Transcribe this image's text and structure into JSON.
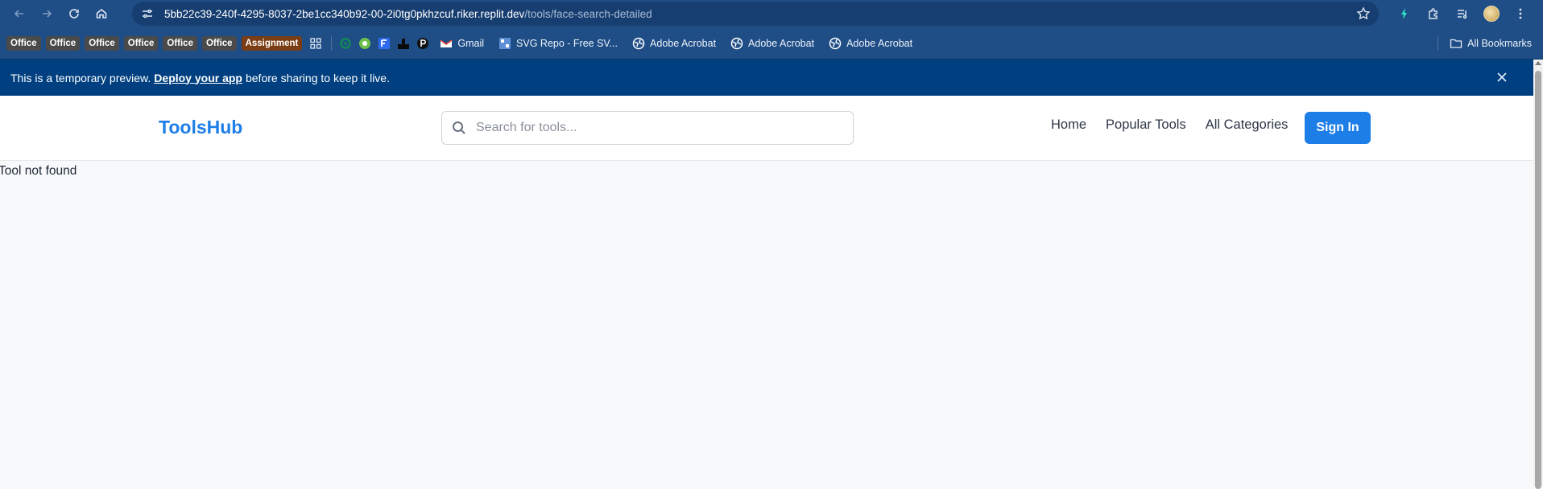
{
  "browser": {
    "url_host": "5bb22c39-240f-4295-8037-2be1cc340b92-00-2i0tg0pkhzcuf.riker.replit.dev",
    "url_path": "/tools/face-search-detailed"
  },
  "bookmarks": {
    "chips": [
      "Office",
      "Office",
      "Office",
      "Office",
      "Office",
      "Office"
    ],
    "assignment": "Assignment",
    "gmail": "Gmail",
    "svg_repo": "SVG Repo - Free SV...",
    "acrobat_1": "Adobe Acrobat",
    "acrobat_2": "Adobe Acrobat",
    "acrobat_3": "Adobe Acrobat",
    "all_bookmarks": "All Bookmarks"
  },
  "banner": {
    "prefix": "This is a temporary preview.",
    "link": "Deploy your app",
    "suffix": "before sharing to keep it live."
  },
  "header": {
    "logo": "ToolsHub",
    "search_placeholder": "Search for tools...",
    "nav": [
      "Home",
      "Popular Tools",
      "All Categories"
    ],
    "sign_in": "Sign In"
  },
  "main": {
    "message": "Tool not found"
  },
  "colors": {
    "chrome_bg": "#1f4d86",
    "banner_bg": "#003f80",
    "brand": "#1e7ee8"
  }
}
